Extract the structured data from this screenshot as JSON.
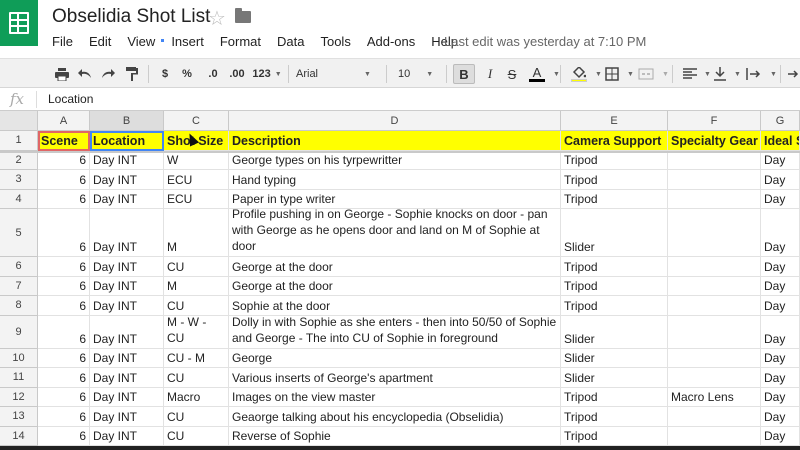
{
  "app": {
    "title": "Obselidia Shot List",
    "last_edit": "Last edit was yesterday at 7:10 PM",
    "menus": [
      "File",
      "Edit",
      "View",
      "Insert",
      "Format",
      "Data",
      "Tools",
      "Add-ons",
      "Help"
    ]
  },
  "toolbar": {
    "currency": "$",
    "percent": "%",
    "decrease_decimals": ".0",
    "increase_decimals": ".00",
    "more_formats": "123",
    "font": "Arial",
    "font_size": "10",
    "bold": "B",
    "italic": "I",
    "strikethrough": "S",
    "text_color": "A",
    "text_color_hex": "#000000",
    "fill_color_hex": "#ffff00"
  },
  "formula_bar": {
    "fx_label": "fx",
    "value": "Location"
  },
  "columns": [
    "A",
    "B",
    "C",
    "D",
    "E",
    "F",
    "G"
  ],
  "header_row": {
    "row": "1",
    "cells": [
      "Scene",
      "Location",
      "Shot Size",
      "Description",
      "Camera Support",
      "Specialty Gear",
      "Ideal S"
    ]
  },
  "rows": [
    {
      "row": "2",
      "cells": [
        "6",
        "Day INT",
        "W",
        "George types on his tyrpewritter",
        "Tripod",
        "",
        "Day"
      ]
    },
    {
      "row": "3",
      "cells": [
        "6",
        "Day INT",
        "ECU",
        "Hand typing",
        "Tripod",
        "",
        "Day"
      ]
    },
    {
      "row": "4",
      "cells": [
        "6",
        "Day INT",
        "ECU",
        "Paper in type writer",
        "Tripod",
        "",
        "Day"
      ]
    },
    {
      "row": "5",
      "cells": [
        "6",
        "Day INT",
        "M",
        "Profile pushing in on George - Sophie knocks on door - pan with George as he opens door and land on M of Sophie at door",
        "Slider",
        "",
        "Day"
      ]
    },
    {
      "row": "6",
      "cells": [
        "6",
        "Day INT",
        "CU",
        "George at the door",
        "Tripod",
        "",
        "Day"
      ]
    },
    {
      "row": "7",
      "cells": [
        "6",
        "Day INT",
        "M",
        "George at the door",
        "Tripod",
        "",
        "Day"
      ]
    },
    {
      "row": "8",
      "cells": [
        "6",
        "Day INT",
        "CU",
        "Sophie at the door",
        "Tripod",
        "",
        "Day"
      ]
    },
    {
      "row": "9",
      "cells": [
        "6",
        "Day INT",
        "M - W - CU",
        "Dolly in with Sophie as she enters - then into 50/50 of Sophie and George - The into CU of Sophie in foreground",
        "Slider",
        "",
        "Day"
      ]
    },
    {
      "row": "10",
      "cells": [
        "6",
        "Day INT",
        "CU - M",
        "George",
        "Slider",
        "",
        "Day"
      ]
    },
    {
      "row": "11",
      "cells": [
        "6",
        "Day INT",
        "CU",
        "Various inserts of George's apartment",
        "Slider",
        "",
        "Day"
      ]
    },
    {
      "row": "12",
      "cells": [
        "6",
        "Day INT",
        "Macro",
        "Images on the view master",
        "Tripod",
        "Macro Lens",
        "Day"
      ]
    },
    {
      "row": "13",
      "cells": [
        "6",
        "Day INT",
        "CU",
        "Geaorge talking about his encyclopedia (Obselidia)",
        "Tripod",
        "",
        "Day"
      ]
    },
    {
      "row": "14",
      "cells": [
        "6",
        "Day INT",
        "CU",
        "Reverse of Sophie",
        "Tripod",
        "",
        "Day"
      ]
    }
  ],
  "colors": {
    "brand": "#0f9d58",
    "header_fill": "#ffff00",
    "selection": "#4285f4"
  }
}
